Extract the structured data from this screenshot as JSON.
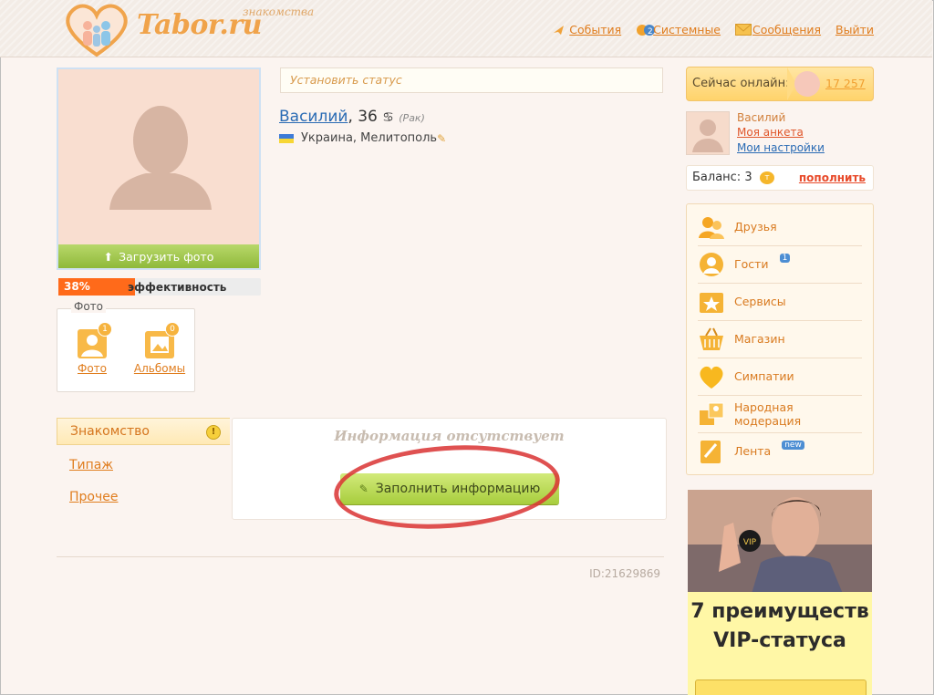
{
  "header": {
    "logo_tagline": "знакомства",
    "logo_text": "Tabor.ru",
    "nav": [
      {
        "label": "События",
        "icon": "bell-icon"
      },
      {
        "label": "Системные",
        "icon": "info-icon"
      },
      {
        "label": "Сообщения",
        "icon": "envelope-icon"
      },
      {
        "label": "Выйти",
        "icon": ""
      }
    ]
  },
  "profile": {
    "upload_label": "Загрузить фото",
    "efficiency_percent": 38,
    "efficiency_text": "38%",
    "efficiency_label": "эффективность",
    "photo_section_title": "Фото",
    "photo_items": [
      {
        "label": "Фото",
        "badge": "1"
      },
      {
        "label": "Альбомы",
        "badge": "0"
      }
    ],
    "status_placeholder": "Установить статус",
    "name": "Василий",
    "age": ", 36",
    "zodiac_sign": "♋",
    "zodiac_name": "(Рак)",
    "location": "Украина, Мелитополь"
  },
  "left_menu": {
    "active": "Знакомство",
    "items": [
      "Типаж",
      "Прочее"
    ]
  },
  "info": {
    "empty_text": "Информация отсутствует",
    "fill_button": "Заполнить информацию"
  },
  "user_id": "ID:21629869",
  "sidebar": {
    "online_label": "Сейчас онлайн:",
    "online_count": "17 257",
    "me_name": "Василий",
    "my_profile": "Моя анкета",
    "my_settings": "Мои настройки",
    "balance_label": "Баланс: 3",
    "balance_coin": "т",
    "topup": "пополнить",
    "menu": [
      {
        "label": "Друзья",
        "icon": "friends-icon",
        "badge": ""
      },
      {
        "label": "Гости",
        "icon": "guests-icon",
        "badge": "1"
      },
      {
        "label": "Сервисы",
        "icon": "star-icon",
        "badge": ""
      },
      {
        "label": "Магазин",
        "icon": "basket-icon",
        "badge": ""
      },
      {
        "label": "Симпатии",
        "icon": "heart-icon",
        "badge": ""
      },
      {
        "label": "Народная модерация",
        "icon": "moderation-icon",
        "badge": ""
      },
      {
        "label": "Лента",
        "icon": "feed-icon",
        "badge": "new"
      }
    ],
    "ad_badge": "VIP",
    "ad_title_line1": "7 преимуществ",
    "ad_title_line2": "VIP-статуса"
  },
  "colors": {
    "accent": "#e07d1e",
    "link_blue": "#2a6bb4",
    "button_green": "#a7cd3d",
    "efficiency": "#ff6a1a"
  }
}
